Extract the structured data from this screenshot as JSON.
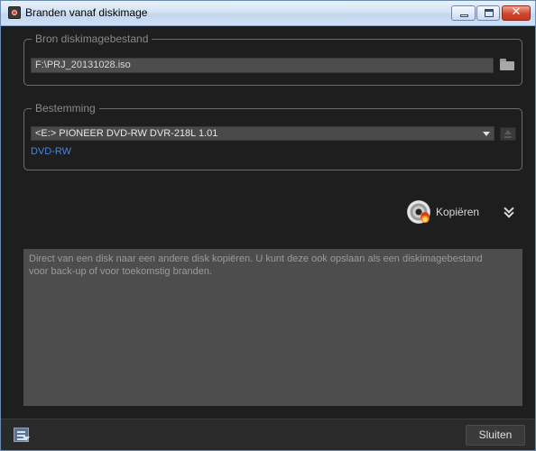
{
  "window": {
    "title": "Branden vanaf diskimage"
  },
  "source": {
    "legend": "Bron diskimagebestand",
    "path": "F:\\PRJ_20131028.iso"
  },
  "destination": {
    "legend": "Bestemming",
    "selected_drive": "<E:>  PIONEER DVD-RW  DVR-218L 1.01",
    "disc_type": "DVD-RW"
  },
  "action": {
    "copy_label": "Kopiëren"
  },
  "description": {
    "line1": "Direct van een disk naar een andere disk kopiëren. U kunt deze ook opslaan als een diskimagebestand",
    "line2": "voor back-up of voor toekomstig branden."
  },
  "footer": {
    "close_label": "Sluiten"
  },
  "colors": {
    "background": "#1e1e1e",
    "field": "#4d4d4d",
    "link_blue": "#4a86d6",
    "text_light": "#d8d8d8",
    "text_dim": "#9a9a9a"
  },
  "icons": [
    "app-icon",
    "minimize-icon",
    "maximize-icon",
    "close-icon",
    "folder-icon",
    "dropdown-arrow-icon",
    "eject-icon",
    "disc-burn-icon",
    "expand-chevron-icon",
    "log-list-icon"
  ]
}
